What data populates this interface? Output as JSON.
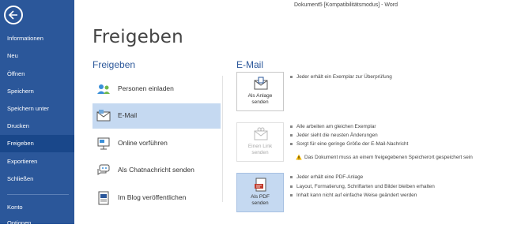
{
  "window_title": "Dokument5 [Kompatibilitätsmodus] - Word",
  "nav": {
    "items": [
      {
        "label": "Informationen",
        "active": false
      },
      {
        "label": "Neu",
        "active": false
      },
      {
        "label": "Öffnen",
        "active": false
      },
      {
        "label": "Speichern",
        "active": false
      },
      {
        "label": "Speichern unter",
        "active": false
      },
      {
        "label": "Drucken",
        "active": false
      },
      {
        "label": "Freigeben",
        "active": true
      },
      {
        "label": "Exportieren",
        "active": false
      },
      {
        "label": "Schließen",
        "active": false
      }
    ],
    "bottom_items": [
      {
        "label": "Konto"
      },
      {
        "label": "Optionen"
      }
    ]
  },
  "page_title": "Freigeben",
  "share": {
    "heading": "Freigeben",
    "options": [
      {
        "label": "Personen einladen",
        "icon": "people-icon",
        "active": false
      },
      {
        "label": "E-Mail",
        "icon": "email-icon",
        "active": true
      },
      {
        "label": "Online vorführen",
        "icon": "present-online-icon",
        "active": false
      },
      {
        "label": "Als Chatnachricht senden",
        "icon": "chat-icon",
        "active": false
      },
      {
        "label": "Im Blog veröffentlichen",
        "icon": "blog-icon",
        "active": false
      }
    ]
  },
  "email": {
    "heading": "E-Mail",
    "attachment": {
      "label_line1": "Als Anlage",
      "label_line2": "senden",
      "bullets": [
        "Jeder erhält ein Exemplar zur Überprüfung"
      ]
    },
    "link": {
      "label_line1": "Einen Link",
      "label_line2": "senden",
      "enabled": false,
      "bullets": [
        "Alle arbeiten am gleichen Exemplar",
        "Jeder sieht die neusten Änderungen",
        "Sorgt für eine geringe Größe der E-Mail-Nachricht"
      ],
      "warning": "Das Dokument muss an einem freigegebenen Speicherort gespeichert sein"
    },
    "pdf": {
      "label_line1": "Als PDF",
      "label_line2": "senden",
      "bullets": [
        "Jeder erhält eine PDF-Anlage",
        "Layout, Formatierung, Schriftarten und Bilder bleiben erhalten",
        "Inhalt kann nicht auf einfache Weise geändert werden"
      ]
    }
  },
  "colors": {
    "nav_bg": "#2b579a",
    "nav_active": "#19478a",
    "accent_text": "#2b579a",
    "selected_bg": "#c5d9f1",
    "warning": "#f0b400"
  }
}
